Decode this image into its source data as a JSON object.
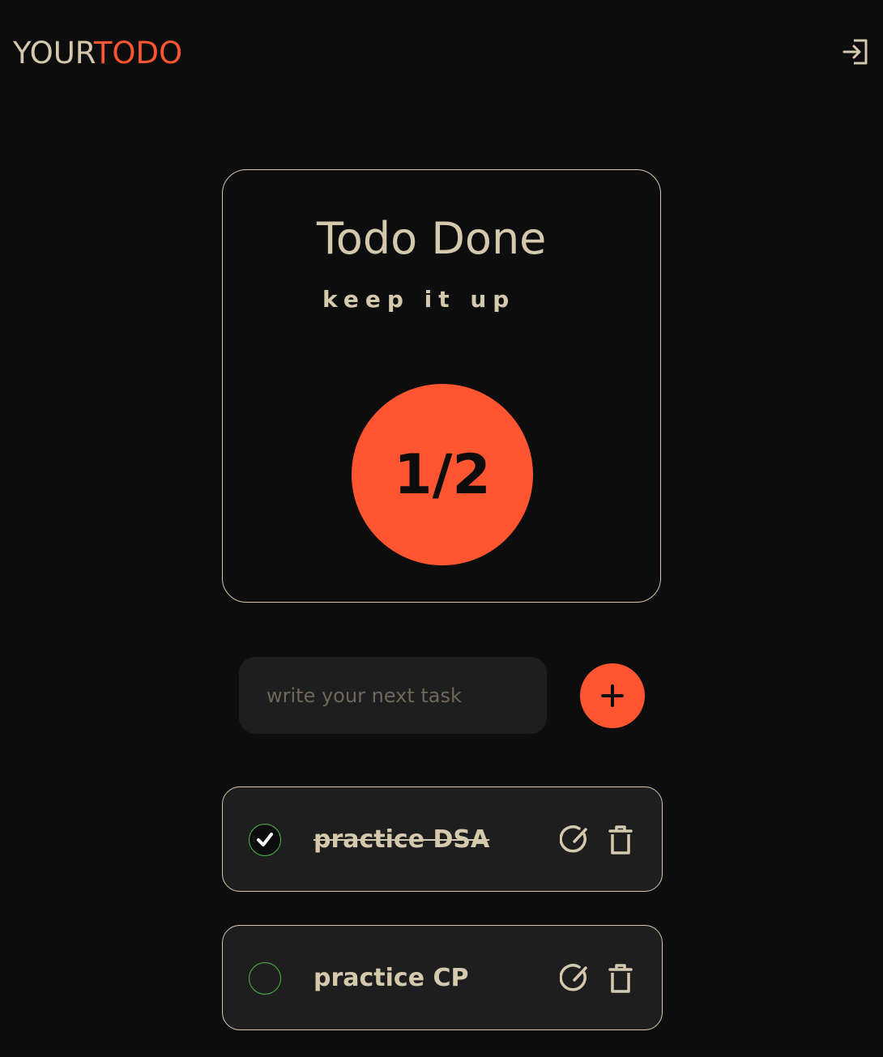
{
  "header": {
    "logo_part1": "YOUR",
    "logo_part2": "TODO",
    "logout_icon": "logout-icon"
  },
  "stats": {
    "title": "Todo Done",
    "subtitle": "keep it up",
    "progress_text": "1/2"
  },
  "input": {
    "placeholder": "write your next task",
    "value": ""
  },
  "todos": [
    {
      "text": "practice DSA",
      "done": true
    },
    {
      "text": "practice CP",
      "done": false
    }
  ],
  "colors": {
    "background": "#0d0d0d",
    "accent": "#ff5631",
    "text": "#d4c8ad",
    "card": "#1e1e1e",
    "check": "#4cbb4c"
  }
}
